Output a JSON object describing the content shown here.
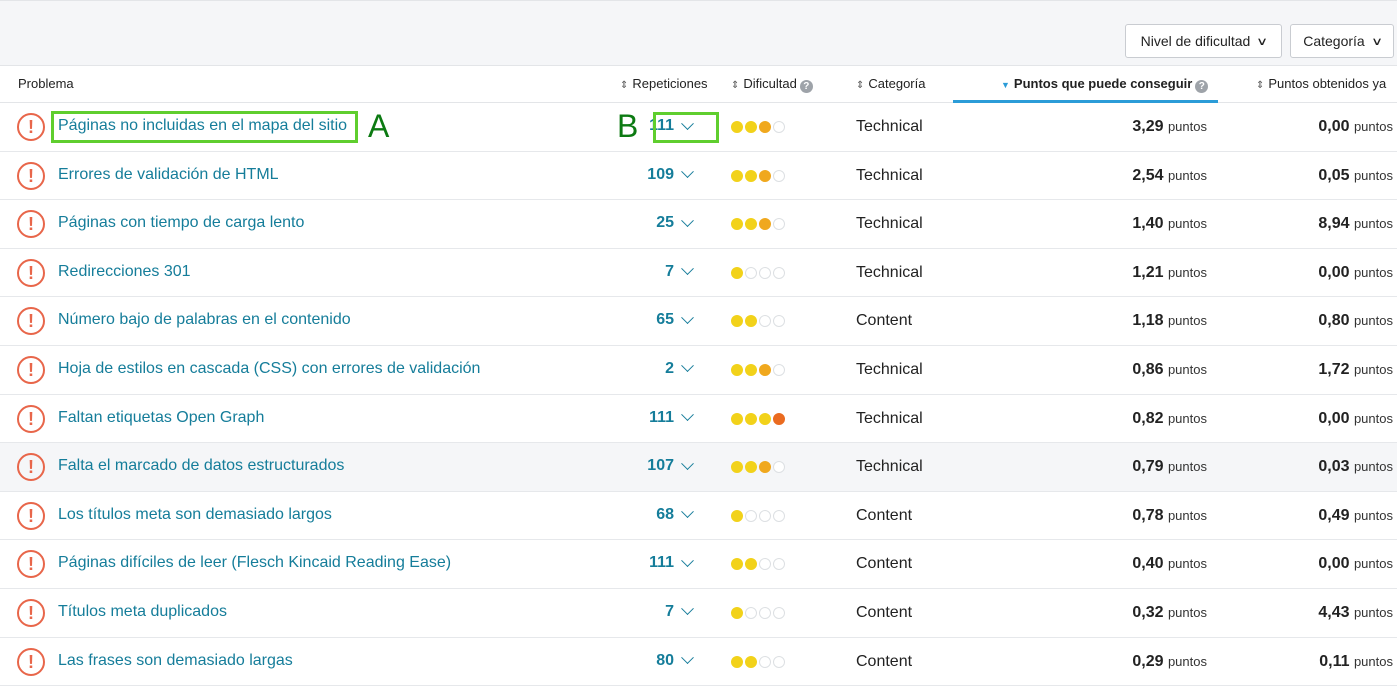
{
  "filters": {
    "difficulty_label": "Nivel de dificultad",
    "category_label": "Categoría"
  },
  "columns": {
    "problem": "Problema",
    "repetitions": "Repeticiones",
    "difficulty": "Dificultad",
    "category": "Categoría",
    "points_possible": "Puntos que puede conseguir",
    "points_obtained": "Puntos obtenidos ya"
  },
  "unit": "puntos",
  "rows": [
    {
      "problem": "Páginas no incluidas en el mapa del sitio",
      "reps": "111",
      "difficulty": 3,
      "category": "Technical",
      "points": "3,29",
      "obtained": "0,00"
    },
    {
      "problem": "Errores de validación de HTML",
      "reps": "109",
      "difficulty": 3,
      "category": "Technical",
      "points": "2,54",
      "obtained": "0,05"
    },
    {
      "problem": "Páginas con tiempo de carga lento",
      "reps": "25",
      "difficulty": 3,
      "category": "Technical",
      "points": "1,40",
      "obtained": "8,94"
    },
    {
      "problem": "Redirecciones 301",
      "reps": "7",
      "difficulty": 1,
      "category": "Technical",
      "points": "1,21",
      "obtained": "0,00"
    },
    {
      "problem": "Número bajo de palabras en el contenido",
      "reps": "65",
      "difficulty": 2,
      "category": "Content",
      "points": "1,18",
      "obtained": "0,80"
    },
    {
      "problem": "Hoja de estilos en cascada (CSS) con errores de validación",
      "reps": "2",
      "difficulty": 3,
      "category": "Technical",
      "points": "0,86",
      "obtained": "1,72"
    },
    {
      "problem": "Faltan etiquetas Open Graph",
      "reps": "111",
      "difficulty": 4,
      "category": "Technical",
      "points": "0,82",
      "obtained": "0,00"
    },
    {
      "problem": "Falta el marcado de datos estructurados",
      "reps": "107",
      "difficulty": 3,
      "category": "Technical",
      "points": "0,79",
      "obtained": "0,03"
    },
    {
      "problem": "Los títulos meta son demasiado largos",
      "reps": "68",
      "difficulty": 1,
      "category": "Content",
      "points": "0,78",
      "obtained": "0,49"
    },
    {
      "problem": "Páginas difíciles de leer (Flesch Kincaid Reading Ease)",
      "reps": "111",
      "difficulty": 2,
      "category": "Content",
      "points": "0,40",
      "obtained": "0,00"
    },
    {
      "problem": "Títulos meta duplicados",
      "reps": "7",
      "difficulty": 1,
      "category": "Content",
      "points": "0,32",
      "obtained": "4,43"
    },
    {
      "problem": "Las frases son demasiado largas",
      "reps": "80",
      "difficulty": 2,
      "category": "Content",
      "points": "0,29",
      "obtained": "0,11"
    }
  ],
  "annotations": {
    "a_label": "A",
    "b_label": "B"
  },
  "colors": {
    "link": "#157d9a",
    "issue_icon": "#e8664a",
    "highlight": "#5fce2e",
    "annotation_text": "#0c7a12",
    "active_sort": "#2b9cd8"
  }
}
